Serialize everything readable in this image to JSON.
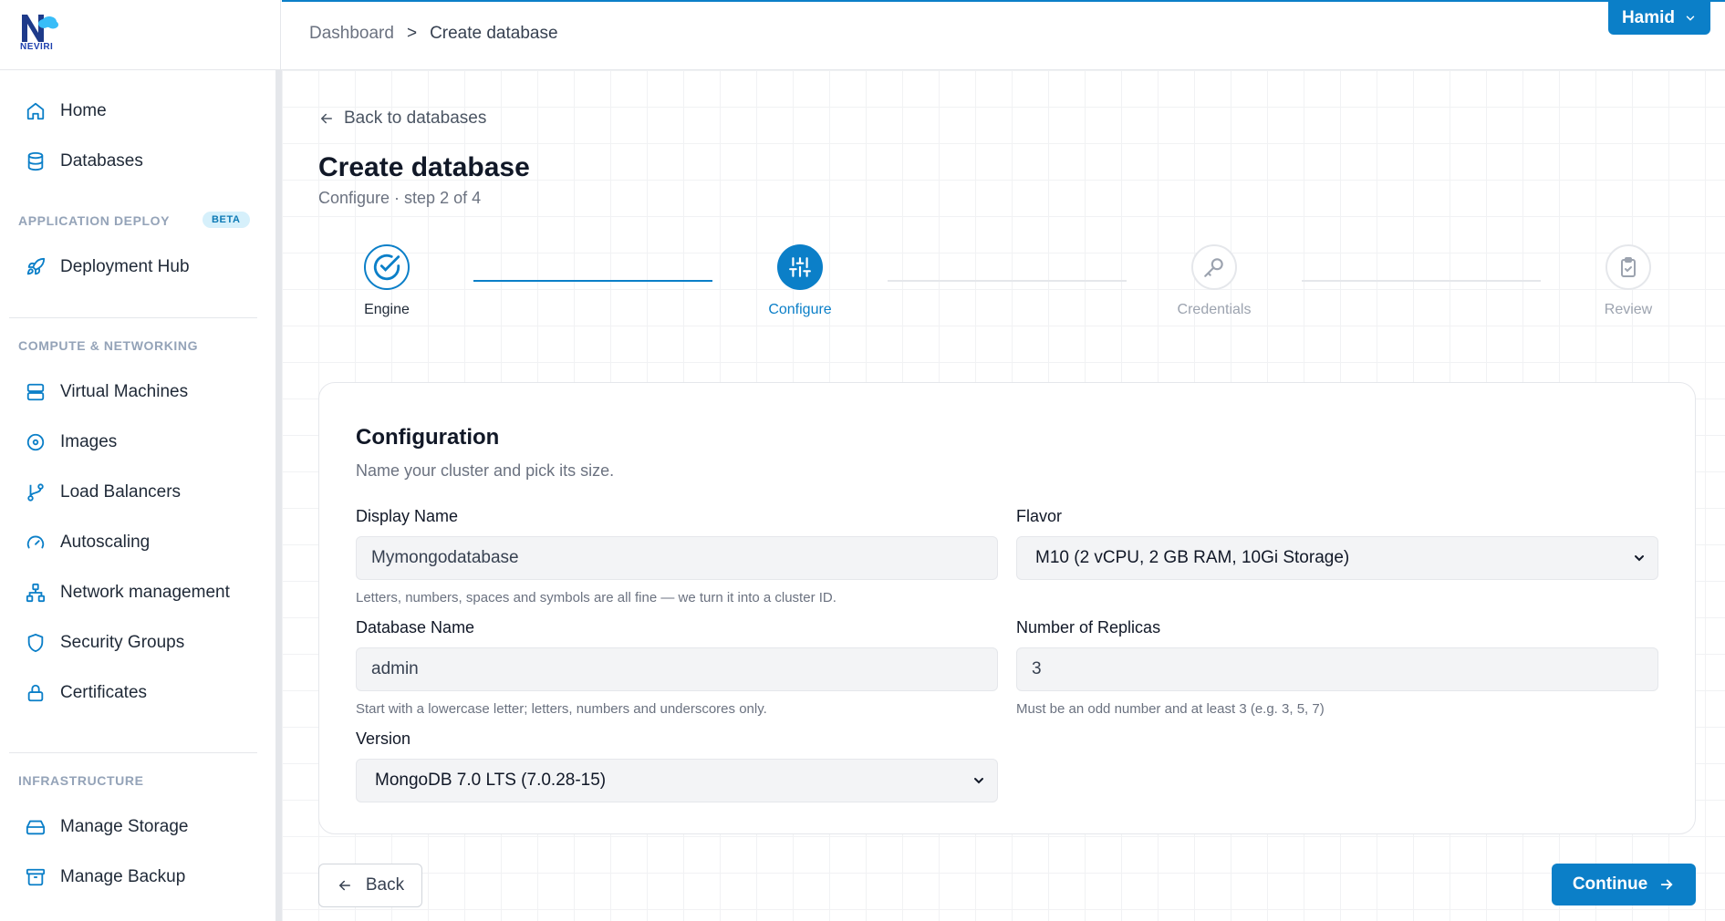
{
  "brand": {
    "name": "NEVIRI"
  },
  "sidebar": {
    "items_top": [
      {
        "label": "Home",
        "icon": "home-icon"
      },
      {
        "label": "Databases",
        "icon": "database-icon"
      }
    ],
    "sections": [
      {
        "label": "APPLICATION DEPLOY",
        "badge": "BETA",
        "items": [
          {
            "label": "Deployment Hub",
            "icon": "rocket-icon"
          }
        ]
      },
      {
        "label": "COMPUTE & NETWORKING",
        "items": [
          {
            "label": "Virtual Machines",
            "icon": "server-icon"
          },
          {
            "label": "Images",
            "icon": "disc-icon"
          },
          {
            "label": "Load Balancers",
            "icon": "git-branch-icon"
          },
          {
            "label": "Autoscaling",
            "icon": "gauge-icon"
          },
          {
            "label": "Network management",
            "icon": "network-icon"
          },
          {
            "label": "Security Groups",
            "icon": "shield-icon"
          },
          {
            "label": "Certificates",
            "icon": "lock-icon"
          }
        ]
      },
      {
        "label": "INFRASTRUCTURE",
        "items": [
          {
            "label": "Manage Storage",
            "icon": "hard-drive-icon"
          },
          {
            "label": "Manage Backup",
            "icon": "archive-icon"
          }
        ]
      }
    ]
  },
  "topbar": {
    "breadcrumb": [
      "Dashboard",
      ">",
      "Create database"
    ],
    "user": "Hamid"
  },
  "page": {
    "back_label": "Back to databases",
    "title": "Create database",
    "subtitle": "Configure · step 2 of 4"
  },
  "stepper": {
    "steps": [
      {
        "label": "Engine",
        "state": "done",
        "icon": "check-circle-icon"
      },
      {
        "label": "Configure",
        "state": "active",
        "icon": "sliders-icon"
      },
      {
        "label": "Credentials",
        "state": "pending",
        "icon": "key-icon"
      },
      {
        "label": "Review",
        "state": "pending",
        "icon": "clipboard-check-icon"
      }
    ]
  },
  "form": {
    "title": "Configuration",
    "subtitle": "Name your cluster and pick its size.",
    "display_name": {
      "label": "Display Name",
      "value": "Mymongodatabase",
      "help": "Letters, numbers, spaces and symbols are all fine — we turn it into a cluster ID."
    },
    "flavor": {
      "label": "Flavor",
      "value": "M10 (2 vCPU, 2 GB RAM, 10Gi Storage)"
    },
    "database_name": {
      "label": "Database Name",
      "value": "admin",
      "help": "Start with a lowercase letter; letters, numbers and underscores only."
    },
    "replicas": {
      "label": "Number of Replicas",
      "value": "3",
      "help": "Must be an odd number and at least 3 (e.g. 3, 5, 7)"
    },
    "version": {
      "label": "Version",
      "value": "MongoDB 7.0 LTS (7.0.28-15)"
    }
  },
  "footer": {
    "back": "Back",
    "continue": "Continue"
  },
  "colors": {
    "accent": "#0b7fc8",
    "muted": "#6b7280",
    "border": "#e5e7eb"
  }
}
